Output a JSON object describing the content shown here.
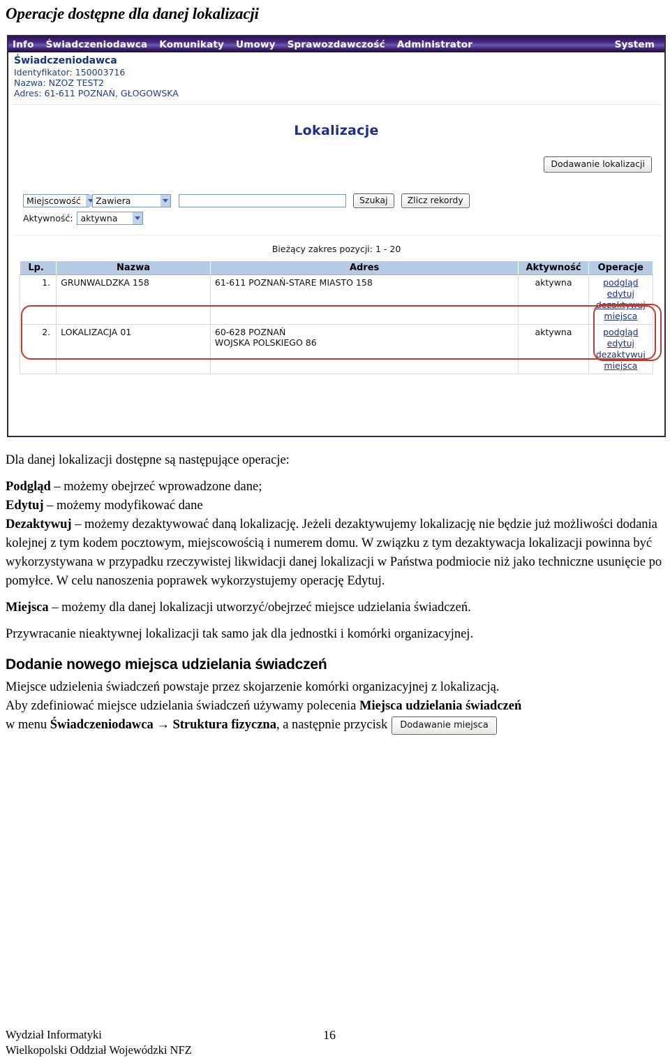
{
  "document": {
    "heading": "Operacje dostępne dla danej lokalizacji",
    "paragraphs": {
      "intro": "Dla danej lokalizacji dostępne są następujące operacje:",
      "podglad_term": "Podgląd",
      "podglad_text": " – możemy obejrzeć wprowadzone dane;",
      "edytuj_term": "Edytuj",
      "edytuj_text": " – możemy modyfikować dane",
      "dezaktywuj_term": "Dezaktywuj",
      "dezaktywuj_text": " – możemy dezaktywować daną lokalizację. Jeżeli dezaktywujemy lokalizację nie będzie już możliwości dodania kolejnej z tym kodem pocztowym, miejscowością i numerem domu. W związku z tym dezaktywacja lokalizacji powinna być wykorzystywana w przypadku rzeczywistej likwidacji danej lokalizacji w Państwa podmiocie niż jako techniczne usunięcie po pomyłce. W celu nanoszenia poprawek wykorzystujemy operację Edytuj.",
      "miejsca_term": "Miejsca",
      "miejsca_text": " – możemy dla danej lokalizacji utworzyć/obejrzeć miejsce udzielania świadczeń.",
      "przywracanie": "Przywracanie nieaktywnej lokalizacji tak samo jak dla jednostki i komórki organizacyjnej."
    },
    "section2": {
      "heading": "Dodanie nowego miejsca udzielania świadczeń",
      "line1": "Miejsce udzielenia świadczeń powstaje przez skojarzenie komórki organizacyjnej z lokalizacją.",
      "line2_a": "Aby zdefiniować miejsce udzielania świadczeń używamy polecenia ",
      "line2_b": "Miejsca udzielania świadczeń",
      "line3_a": "w menu ",
      "line3_b": "Świadczeniodawca",
      "line3_arrow": " → ",
      "line3_c": "Struktura fizyczna",
      "line3_d": ", a następnie przycisk",
      "button_label": "Dodawanie miejsca"
    }
  },
  "footer": {
    "line1": "Wydział Informatyki",
    "line2": "Wielkopolski Oddział Wojewódzki NFZ",
    "page_number": "16"
  },
  "app": {
    "menu": [
      {
        "label": "Info"
      },
      {
        "label": "Świadczeniodawca"
      },
      {
        "label": "Komunikaty"
      },
      {
        "label": "Umowy"
      },
      {
        "label": "Sprawozdawczość"
      },
      {
        "label": "Administrator"
      },
      {
        "label": "System"
      }
    ],
    "provider": {
      "title": "Świadczeniodawca",
      "identyfikator": "Identyfikator: 150003716",
      "nazwa": "Nazwa: NZOZ TEST2",
      "adres": "Adres: 61-611 POZNAŃ, GŁOGOWSKA"
    },
    "title": "Lokalizacje",
    "add_button": "Dodawanie lokalizacji",
    "filters": {
      "column_select": "Miejscowość",
      "operator_select": "Zawiera",
      "search_value": "",
      "search_placeholder": "",
      "search_button": "Szukaj",
      "count_button": "Zlicz rekordy",
      "activity_label": "Aktywność:",
      "activity_select": "aktywna"
    },
    "range_text": "Bieżący zakres pozycji: 1 - 20",
    "table": {
      "headers": [
        "Lp.",
        "Nazwa",
        "Adres",
        "Aktywność",
        "Operacje"
      ],
      "rows": [
        {
          "lp": "1.",
          "nazwa": "GRUNWALDZKA 158",
          "adres_line1": "61-611 POZNAŃ-STARE MIASTO 158",
          "adres_line2": "",
          "aktywnosc": "aktywna",
          "operacje": [
            "podgląd",
            "edytuj",
            "dezaktywuj",
            "miejsca"
          ]
        },
        {
          "lp": "2.",
          "nazwa": "LOKALIZACJA 01",
          "adres_line1": "60-628 POZNAŃ",
          "adres_line2": "WOJSKA POLSKIEGO 86",
          "aktywnosc": "aktywna",
          "operacje": [
            "podgląd",
            "edytuj",
            "dezaktywuj",
            "miejsca"
          ]
        }
      ]
    },
    "colors": {
      "menubar": "#3a2069",
      "title_blue": "#1b2f8a",
      "header_blue": "#b8cbe6",
      "annotation_red": "#c0392b"
    }
  }
}
